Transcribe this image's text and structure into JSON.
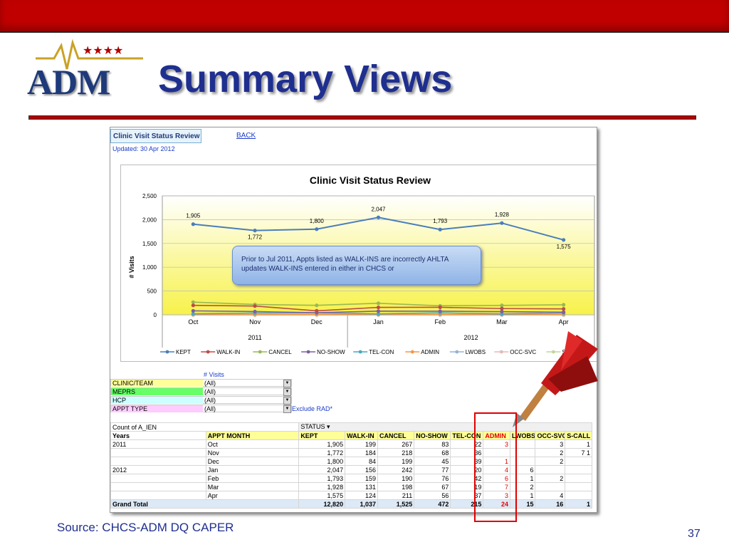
{
  "slide": {
    "logo_text": "ADM",
    "title": "Summary Views",
    "source": "Source:  CHCS-ADM DQ CAPER",
    "page_number": "37",
    "accent_color": "#c00000",
    "title_color": "#1f2f8f"
  },
  "sheet": {
    "title": "Clinic Visit Status Review",
    "back_link": "BACK",
    "updated": "Updated:  30 Apr 2012"
  },
  "chart_data": {
    "type": "line",
    "title": "Clinic Visit Status Review",
    "ylabel": "# Visits",
    "xlabel": "",
    "ylim": [
      0,
      2500
    ],
    "yticks": [
      "0",
      "500",
      "1,000",
      "1,500",
      "2,000",
      "2,500"
    ],
    "categories": [
      "Oct",
      "Nov",
      "Dec",
      "Jan",
      "Feb",
      "Mar",
      "Apr"
    ],
    "year_groups": [
      {
        "label": "2011",
        "span": 3
      },
      {
        "label": "2012",
        "span": 4
      }
    ],
    "kept_labels": [
      "1,905",
      "1,772",
      "1,800",
      "2,047",
      "1,793",
      "1,928",
      "1,575"
    ],
    "series": [
      {
        "name": "KEPT",
        "color": "#4a7ebb",
        "values": [
          1905,
          1772,
          1800,
          2047,
          1793,
          1928,
          1575
        ]
      },
      {
        "name": "WALK-IN",
        "color": "#be4b48",
        "values": [
          199,
          184,
          84,
          156,
          159,
          131,
          124
        ]
      },
      {
        "name": "CANCEL",
        "color": "#98b954",
        "values": [
          267,
          218,
          199,
          242,
          190,
          198,
          211
        ]
      },
      {
        "name": "NO-SHOW",
        "color": "#7d60a0",
        "values": [
          83,
          68,
          45,
          77,
          76,
          67,
          56
        ]
      },
      {
        "name": "TEL-CON",
        "color": "#46aac5",
        "values": [
          22,
          36,
          39,
          20,
          42,
          19,
          37
        ]
      },
      {
        "name": "ADMIN",
        "color": "#f79646",
        "values": [
          3,
          0,
          1,
          4,
          6,
          7,
          3
        ]
      },
      {
        "name": "LWOBS",
        "color": "#95b3d7",
        "values": [
          0,
          0,
          0,
          0,
          0,
          0,
          0
        ]
      },
      {
        "name": "OCC-SVC",
        "color": "#e6b9b8",
        "values": [
          3,
          2,
          2,
          6,
          1,
          2,
          1
        ]
      },
      {
        "name": "S-CALL",
        "color": "#c3d69b",
        "values": [
          1,
          7,
          2,
          0,
          2,
          0,
          4
        ]
      }
    ],
    "legend_position": "bottom",
    "grid": true
  },
  "filters": {
    "visits_label": "# Visits",
    "rows": [
      {
        "label": "CLINIC/TEAM",
        "value": "(All)",
        "color": "#ffff99"
      },
      {
        "label": "MEPRS",
        "value": "(All)",
        "color": "#66ff66"
      },
      {
        "label": "HCP",
        "value": "(All)",
        "color": "#ccffff"
      },
      {
        "label": "APPT TYPE",
        "value": "(All)",
        "color": "#ffccff"
      }
    ],
    "exclude_text": "Exclude RAD*"
  },
  "callout": {
    "text": "Prior to Jul 2011, Appts  listed as WALK-INS are incorrectly AHLTA updates WALK-INS entered in either in CHCS or"
  },
  "pivot": {
    "count_label": "Count of A_IEN",
    "status_label": "STATUS",
    "years_label": "Years",
    "month_label": "APPT MONTH",
    "columns": [
      "KEPT",
      "WALK-IN",
      "CANCEL",
      "NO-SHOW",
      "TEL-CON",
      "ADMIN",
      "LWOBS",
      "OCC-SVC",
      "S-CALL"
    ],
    "rows": [
      {
        "year": "2011",
        "month": "Oct",
        "values": [
          "1,905",
          "199",
          "267",
          "83",
          "22",
          "3",
          "",
          "3",
          "1"
        ]
      },
      {
        "year": "",
        "month": "Nov",
        "values": [
          "1,772",
          "184",
          "218",
          "68",
          "36",
          "",
          "",
          "2",
          "7",
          "1"
        ]
      },
      {
        "year": "",
        "month": "Dec",
        "values": [
          "1,800",
          "84",
          "199",
          "45",
          "39",
          "1",
          "",
          "2",
          ""
        ]
      },
      {
        "year": "2012",
        "month": "Jan",
        "values": [
          "2,047",
          "156",
          "242",
          "77",
          "20",
          "4",
          "6",
          "",
          ""
        ]
      },
      {
        "year": "",
        "month": "Feb",
        "values": [
          "1,793",
          "159",
          "190",
          "76",
          "42",
          "6",
          "1",
          "2",
          ""
        ]
      },
      {
        "year": "",
        "month": "Mar",
        "values": [
          "1,928",
          "131",
          "198",
          "67",
          "19",
          "7",
          "2",
          "",
          ""
        ]
      },
      {
        "year": "",
        "month": "Apr",
        "values": [
          "1,575",
          "124",
          "211",
          "56",
          "37",
          "3",
          "1",
          "4",
          ""
        ]
      }
    ],
    "grand_total_label": "Grand Total",
    "grand_total": [
      "12,820",
      "1,037",
      "1,525",
      "472",
      "215",
      "24",
      "15",
      "16",
      "1"
    ]
  }
}
